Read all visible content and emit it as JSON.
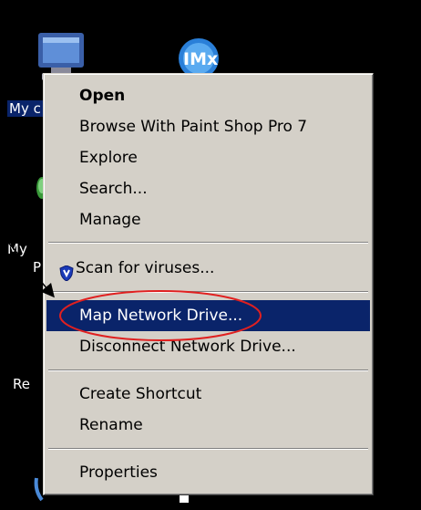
{
  "desktop": {
    "icons": [
      {
        "name": "my-computer",
        "label": "My c"
      },
      {
        "name": "imx-app",
        "label": ""
      },
      {
        "name": "my-network-places",
        "label": "My",
        "label2": "P"
      },
      {
        "name": "recycle-bin",
        "label": "Re"
      }
    ]
  },
  "context_menu": {
    "items": [
      {
        "label": "Open",
        "bold": true
      },
      {
        "label": "Browse With Paint Shop Pro 7"
      },
      {
        "label": "Explore"
      },
      {
        "label": "Search..."
      },
      {
        "label": "Manage"
      },
      {
        "label": "Scan for viruses...",
        "icon": "shield-icon"
      },
      {
        "label": "Map Network Drive...",
        "selected": true
      },
      {
        "label": "Disconnect Network Drive..."
      },
      {
        "label": "Create Shortcut"
      },
      {
        "label": "Rename"
      },
      {
        "label": "Properties"
      }
    ]
  },
  "colors": {
    "desktop_bg": "#000000",
    "menu_bg": "#d4d0c8",
    "highlight": "#0a246a",
    "annotation_red": "#e02020"
  }
}
